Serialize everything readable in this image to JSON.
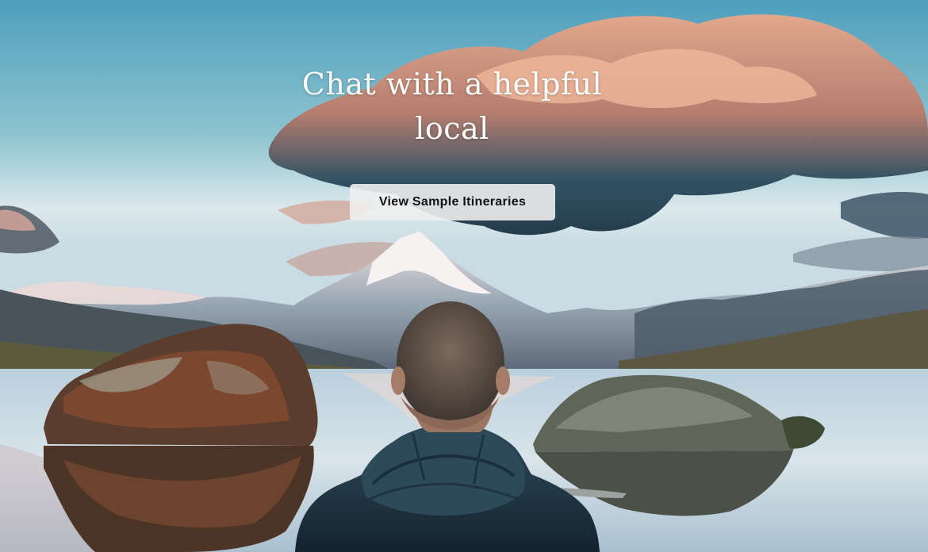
{
  "hero": {
    "headline": "Chat with a helpful local",
    "cta_label": "View Sample Itineraries"
  },
  "colors": {
    "sky_top": "#5aa9c4",
    "sky_bottom": "#dbe8ec",
    "cloud_orange": "#d99a7c",
    "cloud_dark": "#1f3c4e",
    "button_bg": "#eeeeee",
    "text": "#ffffff"
  }
}
